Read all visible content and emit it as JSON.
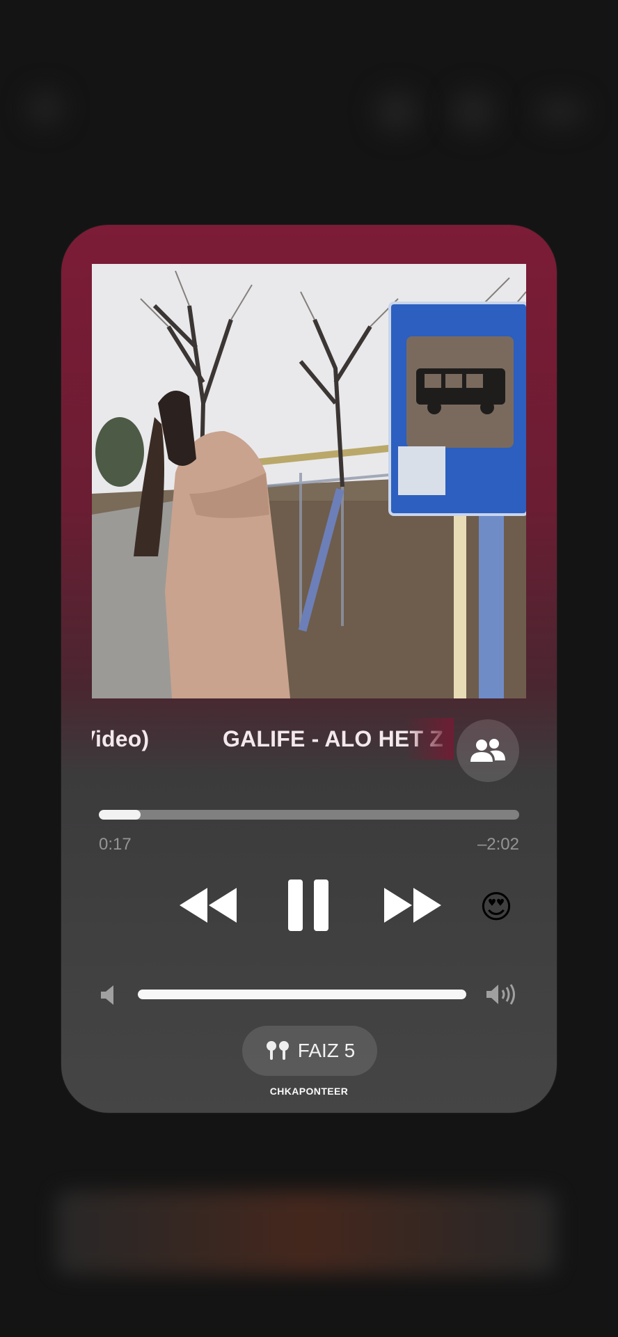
{
  "now_playing": {
    "title_left_fragment": "Video)",
    "title_right_fragment": "GALIFE - ALO HET Z",
    "elapsed": "0:17",
    "remaining": "–2:02",
    "progress_fraction": 0.1,
    "volume_fraction": 1.0,
    "reaction_emoji": "😍"
  },
  "output_device": {
    "label": "FAIZ 5",
    "icon": "airpods-icon"
  },
  "watermark": "CHKAPONTEER",
  "icons": {
    "shareplay": "people-icon",
    "rewind": "backward-icon",
    "pause": "pause-icon",
    "forward": "forward-icon",
    "volume_low": "speaker-low-icon",
    "volume_high": "speaker-high-icon"
  },
  "colors": {
    "card_top": "#7c1c36",
    "card_bottom": "#454545",
    "background": "#141414"
  }
}
